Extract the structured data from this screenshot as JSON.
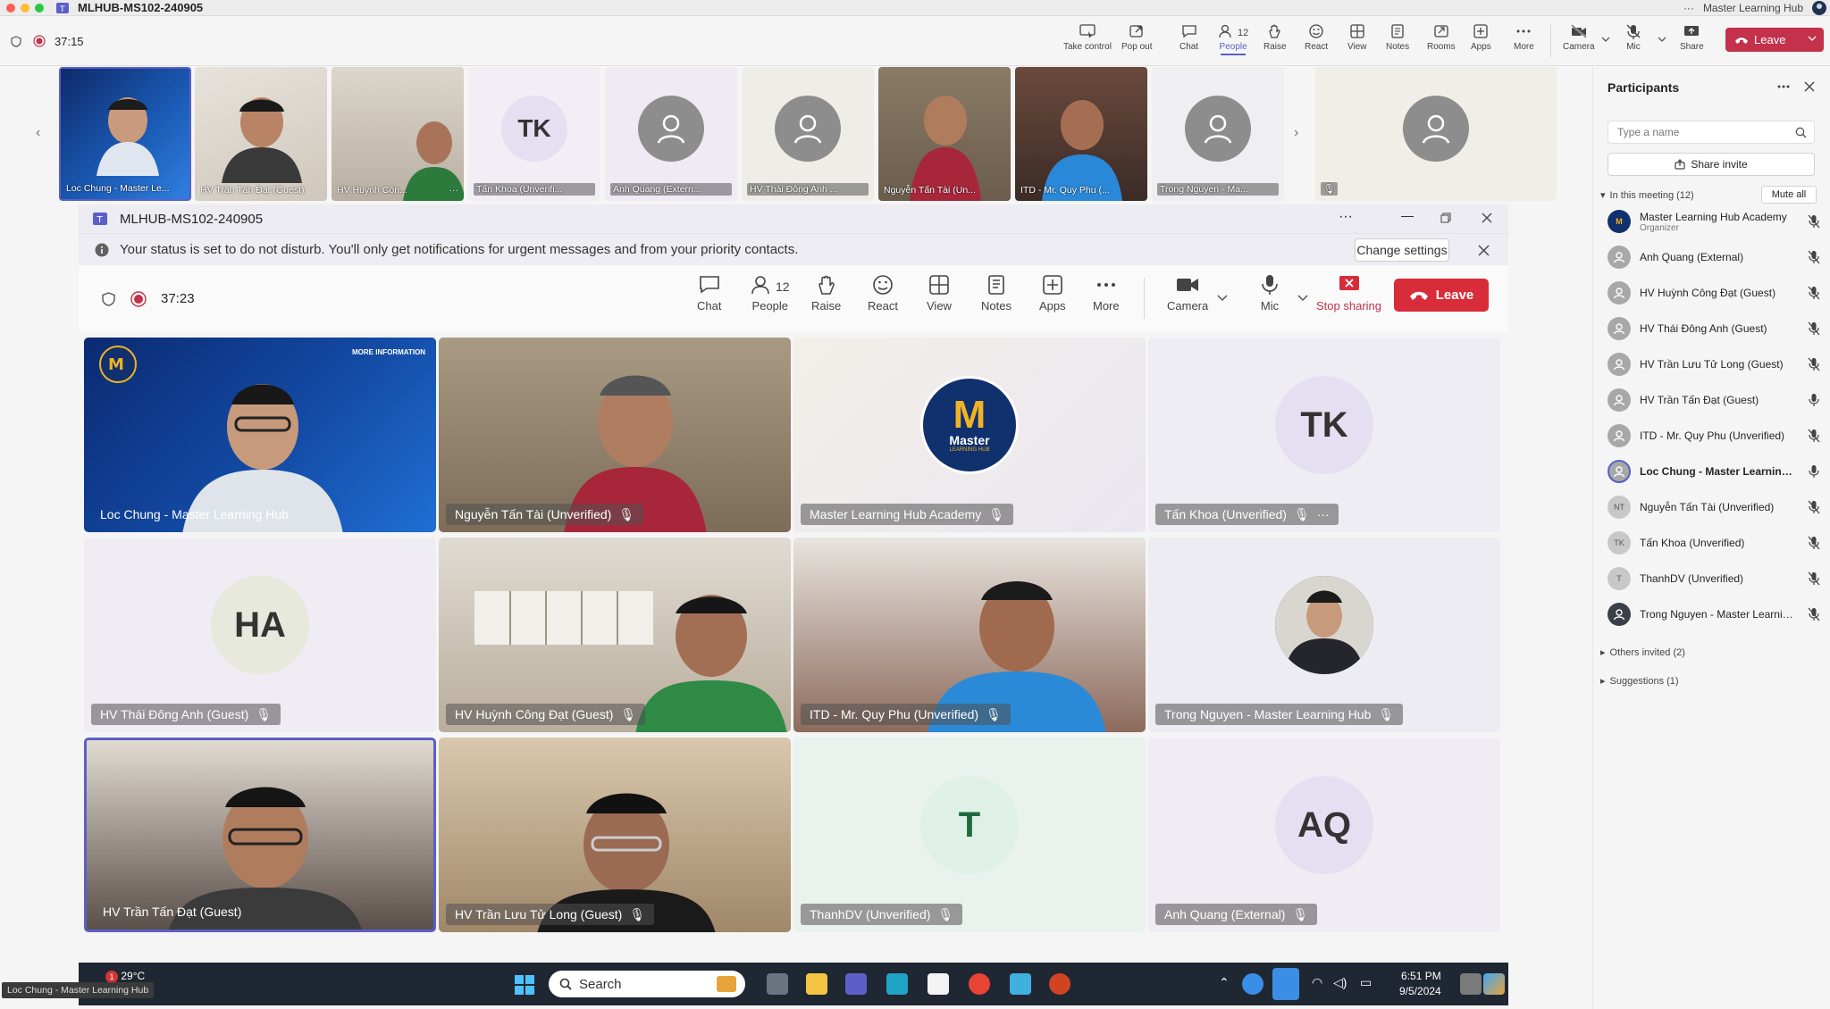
{
  "window": {
    "title": "MLHUB-MS102-240905",
    "account": "Master Learning Hub",
    "more": "···"
  },
  "outer_toolbar": {
    "timer": "37:15",
    "take_control": "Take control",
    "pop_out": "Pop out",
    "chat": "Chat",
    "people": "People",
    "people_count": "12",
    "raise": "Raise",
    "react": "React",
    "view": "View",
    "notes": "Notes",
    "rooms": "Rooms",
    "apps": "Apps",
    "more": "More",
    "camera": "Camera",
    "mic": "Mic",
    "share": "Share",
    "leave": "Leave"
  },
  "filmstrip": [
    {
      "label": "Loc Chung - Master Le...",
      "kind": "video"
    },
    {
      "label": "HV Trần Tấn Đạt (Guest)",
      "kind": "video"
    },
    {
      "label": "HV Huỳnh Côn...",
      "kind": "video"
    },
    {
      "label": "Tấn Khoa (Unverifi...",
      "kind": "initials",
      "initials": "TK"
    },
    {
      "label": "Anh Quang (Extern...",
      "kind": "avatar"
    },
    {
      "label": "HV Thái Đông Anh ...",
      "kind": "avatar"
    },
    {
      "label": "Nguyễn Tấn Tài (Un...",
      "kind": "video"
    },
    {
      "label": "ITD - Mr. Quy Phu (...",
      "kind": "video"
    },
    {
      "label": "Trong Nguyen - Ma...",
      "kind": "avatar"
    },
    {
      "label": "",
      "kind": "avatar"
    }
  ],
  "participants_panel": {
    "title": "Participants",
    "search_placeholder": "Type a name",
    "share_invite": "Share invite",
    "in_meeting": "In this meeting (12)",
    "mute_all": "Mute all",
    "others_invited": "Others invited (2)",
    "suggestions": "Suggestions (1)",
    "people": [
      {
        "name": "Master Learning Hub Academy",
        "sub": "Organizer",
        "avatar": "M",
        "muted": true
      },
      {
        "name": "Anh Quang (External)",
        "sub": "",
        "avatar": "",
        "muted": true
      },
      {
        "name": "HV Huỳnh Công Đạt (Guest)",
        "sub": "",
        "avatar": "",
        "muted": true
      },
      {
        "name": "HV Thái Đông Anh (Guest)",
        "sub": "",
        "avatar": "",
        "muted": true
      },
      {
        "name": "HV Trần Lưu Tử Long (Guest)",
        "sub": "",
        "avatar": "",
        "muted": true
      },
      {
        "name": "HV Trần Tấn Đạt (Guest)",
        "sub": "",
        "avatar": "",
        "muted": false
      },
      {
        "name": "ITD - Mr. Quy Phu (Unverified)",
        "sub": "",
        "avatar": "",
        "muted": true
      },
      {
        "name": "Loc Chung - Master Learning ...",
        "sub": "",
        "avatar": "",
        "muted": false
      },
      {
        "name": "Nguyễn Tấn Tài (Unverified)",
        "sub": "",
        "avatar": "NT",
        "muted": true
      },
      {
        "name": "Tấn Khoa (Unverified)",
        "sub": "",
        "avatar": "TK",
        "muted": true
      },
      {
        "name": "ThanhDV (Unverified)",
        "sub": "",
        "avatar": "T",
        "muted": true
      },
      {
        "name": "Trong Nguyen - Master Learnin...",
        "sub": "",
        "avatar": "",
        "muted": true
      }
    ]
  },
  "shared_window": {
    "title": "MLHUB-MS102-240905",
    "dnd_message": "Your status is set to do not disturb. You'll only get notifications for urgent messages and from your priority contacts.",
    "change_settings": "Change settings",
    "timer": "37:23",
    "toolbar": {
      "chat": "Chat",
      "people": "People",
      "people_count": "12",
      "raise": "Raise",
      "react": "React",
      "view": "View",
      "notes": "Notes",
      "apps": "Apps",
      "more": "More",
      "camera": "Camera",
      "mic": "Mic",
      "stop_sharing": "Stop sharing",
      "leave": "Leave"
    },
    "tiles": [
      {
        "label": "Loc Chung - Master Learning Hub",
        "kind": "video"
      },
      {
        "label": "Nguyễn Tấn Tài (Unverified)",
        "kind": "video"
      },
      {
        "label": "Master Learning Hub Academy",
        "kind": "logo",
        "logo_text": "Master",
        "logo_sub": "LEARNING HUB"
      },
      {
        "label": "Tấn Khoa (Unverified)",
        "kind": "initials",
        "initials": "TK"
      },
      {
        "label": "HV Thái Đông Anh (Guest)",
        "kind": "initials",
        "initials": "HA"
      },
      {
        "label": "HV Huỳnh Công Đạt (Guest)",
        "kind": "video"
      },
      {
        "label": "ITD - Mr. Quy Phu (Unverified)",
        "kind": "video"
      },
      {
        "label": "Trong Nguyen - Master Learning Hub",
        "kind": "photo"
      },
      {
        "label": "HV Trần Tấn Đạt (Guest)",
        "kind": "video"
      },
      {
        "label": "HV Trần Lưu Tử Long (Guest)",
        "kind": "video"
      },
      {
        "label": "ThanhDV (Unverified)",
        "kind": "initials",
        "initials": "T"
      },
      {
        "label": "Anh Quang (External)",
        "kind": "initials",
        "initials": "AQ"
      }
    ],
    "slide_info": "MORE INFORMATION"
  },
  "taskbar": {
    "temperature": "29°C",
    "search": "Search",
    "time": "6:51 PM",
    "date": "9/5/2024",
    "badge": "1"
  },
  "hover_tooltip": "Loc Chung - Master Learning Hub",
  "colors": {
    "accent": "#5b5fc7",
    "leave": "#c4314b",
    "record": "#c4314b"
  }
}
